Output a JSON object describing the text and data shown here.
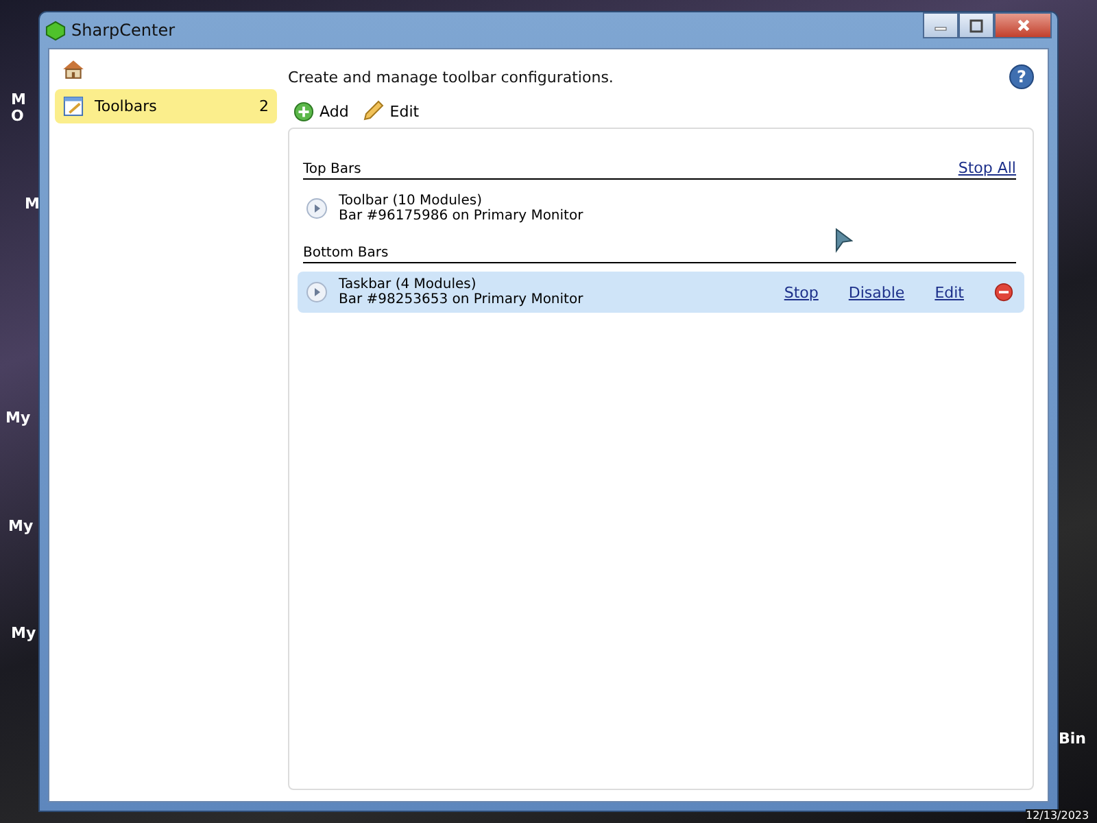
{
  "desktop": {
    "labels": [
      "M",
      "O",
      "M",
      "My",
      "My",
      "My",
      "Bin",
      "12/13/2023"
    ]
  },
  "help": "?",
  "window": {
    "title": "SharpCenter"
  },
  "sidebar": {
    "items": [
      {
        "label": "Toolbars",
        "count": "2",
        "selected": true
      }
    ]
  },
  "description": "Create and manage toolbar configurations.",
  "toolbar": [
    {
      "kind": "add",
      "label": "Add"
    },
    {
      "kind": "edit",
      "label": "Edit"
    }
  ],
  "sections": [
    {
      "title": "Top Bars",
      "action": "Stop All",
      "bars": [
        {
          "name": "Toolbar (10 Modules)",
          "detail": "Bar #96175986 on Primary Monitor",
          "selected": false,
          "removable": false
        }
      ]
    },
    {
      "title": "Bottom Bars",
      "bars": [
        {
          "name": "Taskbar (4 Modules)",
          "detail": "Bar #98253653 on Primary Monitor",
          "selected": true,
          "actions": [
            "Stop",
            "Disable",
            "Edit"
          ],
          "removable": true
        }
      ]
    }
  ]
}
